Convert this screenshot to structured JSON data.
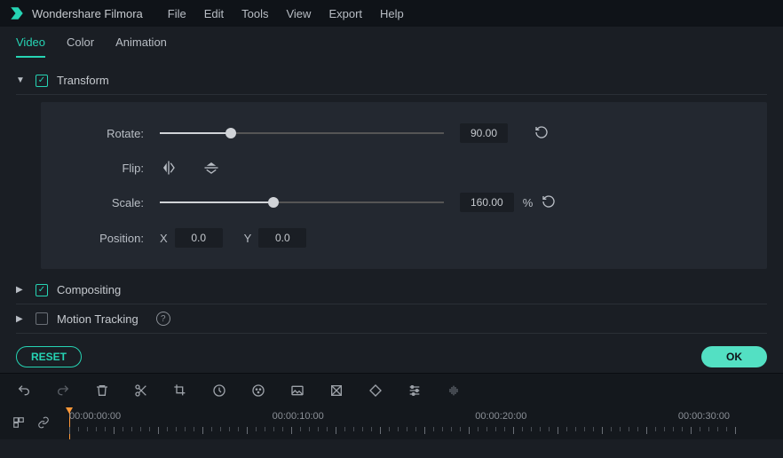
{
  "app": {
    "title": "Wondershare Filmora"
  },
  "menu": [
    "File",
    "Edit",
    "Tools",
    "View",
    "Export",
    "Help"
  ],
  "tabs": [
    "Video",
    "Color",
    "Animation"
  ],
  "activeTab": 0,
  "sections": {
    "transform": {
      "label": "Transform",
      "expanded": true,
      "checked": true
    },
    "compositing": {
      "label": "Compositing",
      "expanded": false,
      "checked": true
    },
    "motionTracking": {
      "label": "Motion Tracking",
      "expanded": false,
      "checked": false
    }
  },
  "transform": {
    "rotateLabel": "Rotate:",
    "rotateValue": "90.00",
    "rotatePct": 25,
    "flipLabel": "Flip:",
    "scaleLabel": "Scale:",
    "scaleValue": "160.00",
    "scaleUnit": "%",
    "scalePct": 40,
    "positionLabel": "Position:",
    "posXLabel": "X",
    "posXValue": "0.0",
    "posYLabel": "Y",
    "posYValue": "0.0"
  },
  "buttons": {
    "reset": "RESET",
    "ok": "OK"
  },
  "timeline": {
    "codes": [
      "00:00:00:00",
      "00:00:10:00",
      "00:00:20:00",
      "00:00:30:00"
    ]
  }
}
